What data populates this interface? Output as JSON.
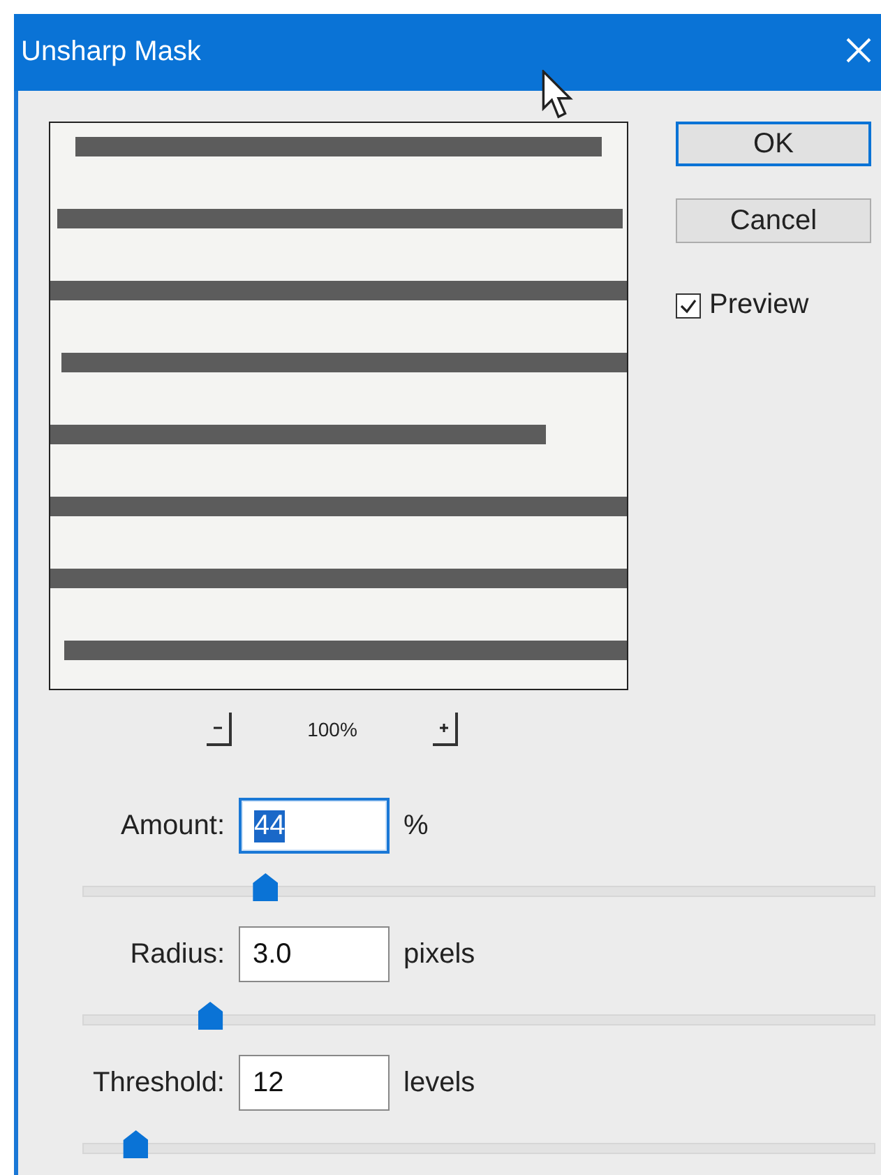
{
  "window": {
    "title": "Unsharp Mask"
  },
  "preview": {
    "kind": "picture",
    "zoom": "100%"
  },
  "buttons": [
    {
      "label": "OK",
      "default": true
    },
    {
      "label": "Cancel",
      "default": false
    }
  ],
  "preview_checkbox": {
    "label": "Preview",
    "checked": true
  },
  "params": [
    {
      "label": "Amount:",
      "value": "44",
      "unit": "%",
      "text_selected": true,
      "level": 0.23
    },
    {
      "label": "Radius:",
      "value": "3.0",
      "unit": "pixels",
      "text_selected": false,
      "level": 0.16
    },
    {
      "label": "Threshold:",
      "value": "12",
      "unit": "levels",
      "text_selected": false,
      "level": 0.066
    }
  ]
}
